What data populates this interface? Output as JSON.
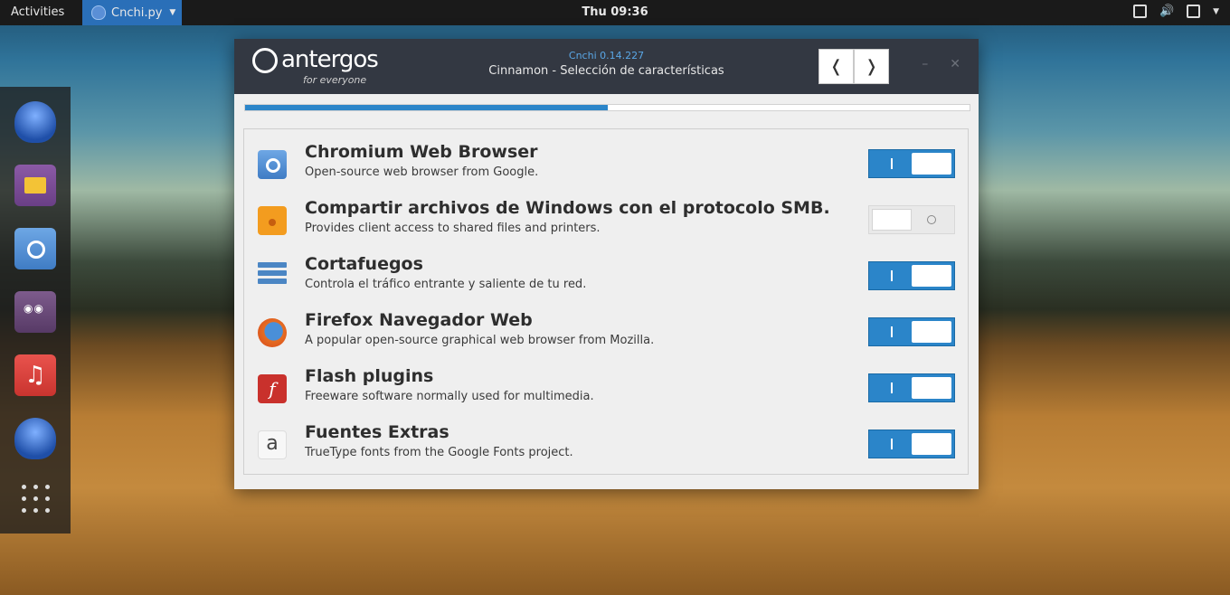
{
  "topbar": {
    "activities": "Activities",
    "app_menu": "Cnchi.py",
    "clock": "Thu 09:36"
  },
  "window": {
    "brand": {
      "name": "antergos",
      "tagline": "for everyone"
    },
    "app_title": "Cnchi  0.14.227",
    "subtitle": "Cinnamon - Selección de características",
    "nav": {
      "back": "❬",
      "forward": "❭"
    },
    "controls": {
      "minimize": "–",
      "close": "✕"
    },
    "progress_fraction": 0.5
  },
  "features": [
    {
      "title": "Chromium Web Browser",
      "desc": "Open-source web browser from Google.",
      "enabled": true,
      "icon": "chromium-icon"
    },
    {
      "title": "Compartir archivos de Windows con el protocolo SMB.",
      "desc": "Provides client access to shared files and printers.",
      "enabled": false,
      "icon": "folder-share-icon"
    },
    {
      "title": "Cortafuegos",
      "desc": "Controla el tráfico entrante y saliente de tu red.",
      "enabled": true,
      "icon": "firewall-icon"
    },
    {
      "title": "Firefox Navegador Web",
      "desc": "A popular open-source graphical web browser from Mozilla.",
      "enabled": true,
      "icon": "firefox-icon"
    },
    {
      "title": "Flash plugins",
      "desc": "Freeware software normally used for multimedia.",
      "enabled": true,
      "icon": "flash-icon"
    },
    {
      "title": "Fuentes Extras",
      "desc": "TrueType fonts from the Google Fonts project.",
      "enabled": true,
      "icon": "fonts-icon"
    }
  ],
  "icons": {
    "flash_glyph": "f",
    "fonts_glyph": "a",
    "music_glyph": "♫"
  },
  "colors": {
    "accent": "#2b85c9",
    "titlebar": "#333842"
  }
}
